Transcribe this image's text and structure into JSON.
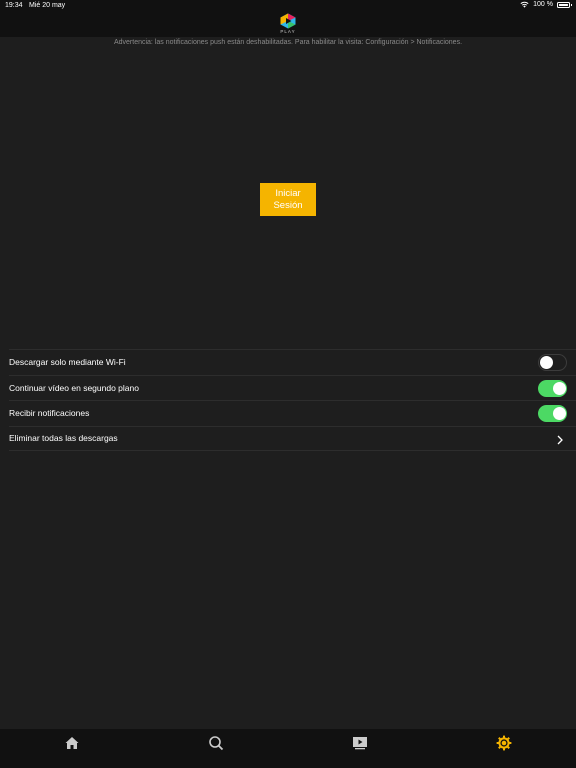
{
  "status_bar": {
    "time": "19:34",
    "date": "Mié 20 may",
    "battery": "100 %",
    "battery_level": 1.0
  },
  "header": {
    "logo_text": "PLAY",
    "logo_colors": [
      "#f5b400",
      "#e6245f",
      "#2fb7e8",
      "#37c26a"
    ]
  },
  "warning": "Advertencia: las notificaciones push están deshabilitadas. Para habilitar la visita: Configuración > Notificaciones.",
  "login_button": "Iniciar Sesión",
  "settings": [
    {
      "label": "Descargar solo mediante Wi-Fi",
      "control": "toggle",
      "on": false
    },
    {
      "label": "Continuar vídeo en segundo plano",
      "control": "toggle",
      "on": true
    },
    {
      "label": "Recibir notificaciones",
      "control": "toggle",
      "on": true
    },
    {
      "label": "Eliminar todas las descargas",
      "control": "chevron-right-icon"
    }
  ],
  "tab_bar": {
    "tabs": [
      {
        "icon": "home-icon",
        "active": false
      },
      {
        "icon": "search-icon",
        "active": false
      },
      {
        "icon": "video-library-icon",
        "active": false
      },
      {
        "icon": "settings-gear-icon",
        "active": true
      }
    ],
    "active_color": "#f5b400",
    "inactive_color": "#cccccc"
  }
}
